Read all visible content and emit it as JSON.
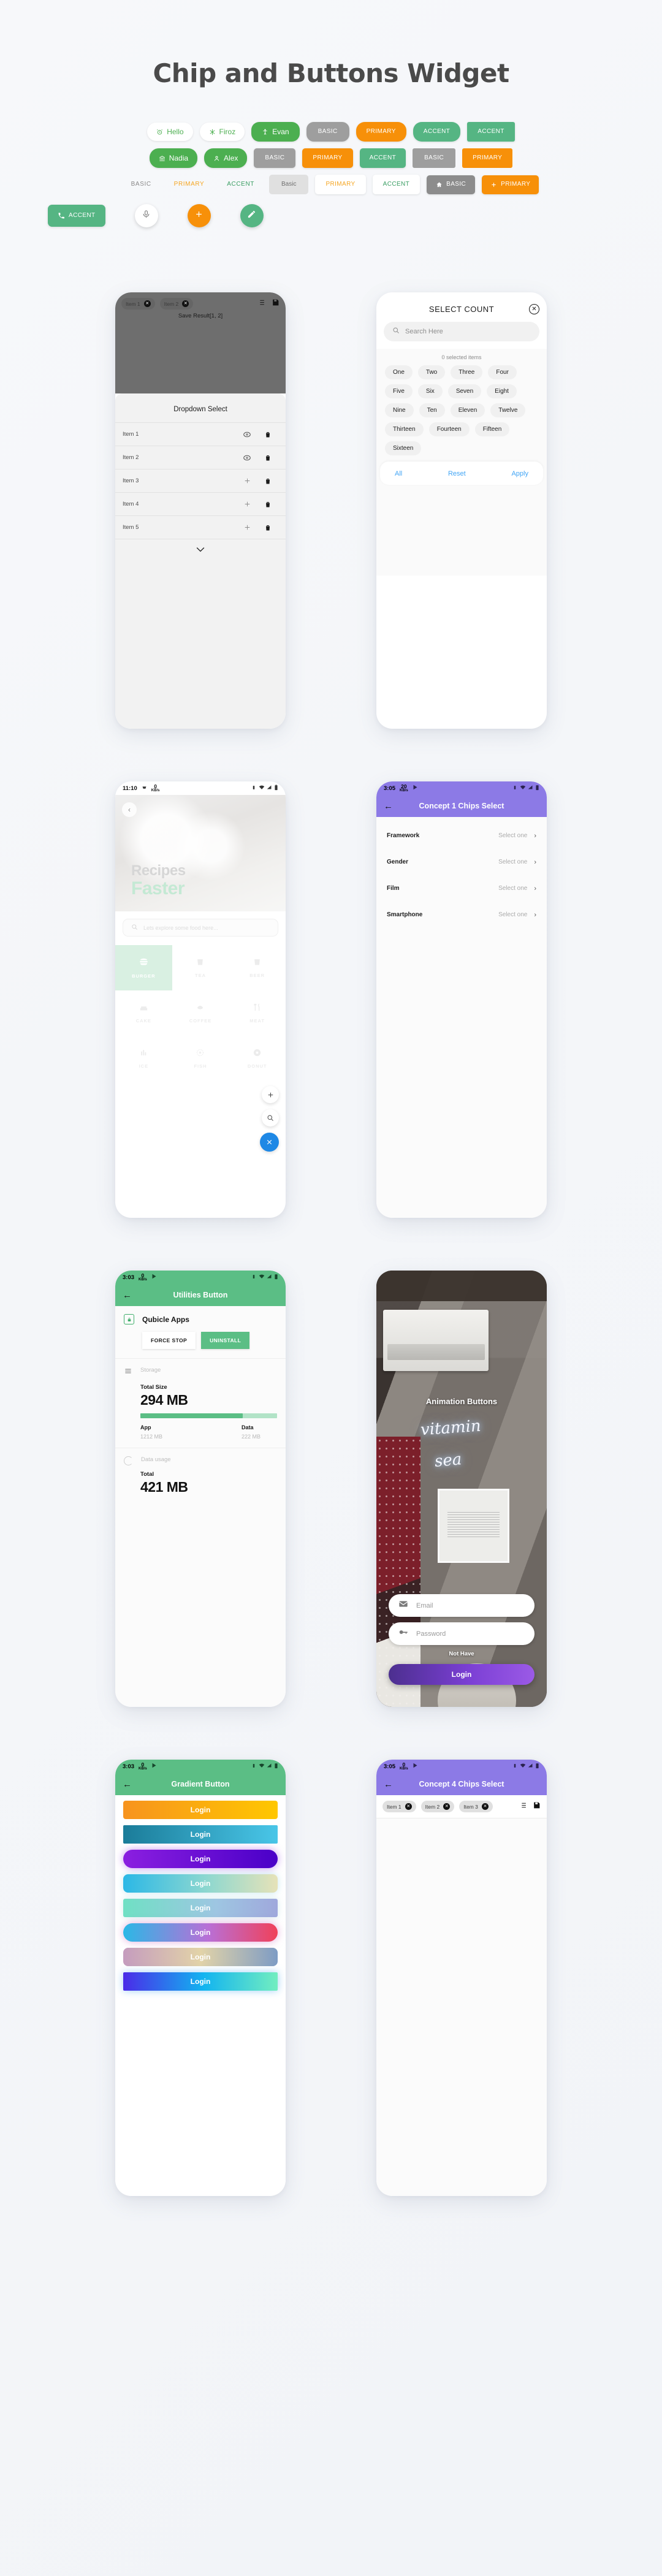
{
  "page": {
    "title": "Chip and Buttons Widget"
  },
  "chip_rows": [
    {
      "id": "row-1",
      "chips": [
        {
          "label": "Hello",
          "style": "c-white-round",
          "icon": "alarm-icon"
        },
        {
          "label": "Firoz",
          "style": "c-white-round",
          "icon": "snowflake-icon"
        },
        {
          "label": "Evan",
          "style": "c-green-round",
          "icon": "accessibility-icon"
        },
        {
          "label": "BASIC",
          "style": "c-gray-soft",
          "icon": ""
        },
        {
          "label": "PRIMARY",
          "style": "c-orange-soft",
          "icon": ""
        },
        {
          "label": "ACCENT",
          "style": "c-accent-soft",
          "icon": ""
        },
        {
          "label": "ACCENT",
          "style": "c-accent-sq",
          "icon": ""
        }
      ]
    },
    {
      "id": "row-2",
      "chips": [
        {
          "label": "Nadia",
          "style": "c-green-round2",
          "icon": "bank-icon"
        },
        {
          "label": "Alex",
          "style": "c-green-round2",
          "icon": "person-icon"
        },
        {
          "label": "BASIC",
          "style": "c-gray-sq",
          "icon": ""
        },
        {
          "label": "PRIMARY",
          "style": "c-orange-sq",
          "icon": ""
        },
        {
          "label": "ACCENT",
          "style": "c-accent-sq2",
          "icon": ""
        },
        {
          "label": "BASIC",
          "style": "c-gray-flat",
          "icon": ""
        },
        {
          "label": "PRIMARY",
          "style": "c-orange-flat",
          "icon": ""
        }
      ]
    },
    {
      "id": "row-3",
      "chips": [
        {
          "label": "BASIC",
          "style": "c-text-basic",
          "icon": ""
        },
        {
          "label": "PRIMARY",
          "style": "c-text-primary",
          "icon": ""
        },
        {
          "label": "ACCENT",
          "style": "c-text-accent",
          "icon": ""
        },
        {
          "label": "Basic",
          "style": "c-tonal-basic",
          "icon": ""
        },
        {
          "label": "PRIMARY",
          "style": "c-outline-primary",
          "icon": ""
        },
        {
          "label": "ACCENT",
          "style": "c-outline-accent",
          "icon": ""
        },
        {
          "label": "BASIC",
          "style": "c-gray-icon",
          "icon": "home-icon"
        },
        {
          "label": "PRIMARY",
          "style": "c-orange-icon",
          "icon": "plus-icon"
        }
      ]
    },
    {
      "id": "row-4",
      "chips": [
        {
          "label": "ACCENT",
          "style": "c-green-call",
          "icon": "phone-icon"
        },
        {
          "label": "",
          "style": "fab fab-white",
          "icon": "mic-icon"
        },
        {
          "label": "",
          "style": "fab fab-orange",
          "icon": "plus-icon"
        },
        {
          "label": "",
          "style": "fab fab-green",
          "icon": "pencil-icon"
        }
      ]
    }
  ],
  "phone_dropdown": {
    "name": "Dropdown Select",
    "top_chips": [
      {
        "label": "Item 1"
      },
      {
        "label": "Item 2"
      }
    ],
    "save_result": "Save Result[1, 2]",
    "sheet_title": "Dropdown Select",
    "items": [
      {
        "label": "Item 1",
        "action": "radio-selected-icon"
      },
      {
        "label": "Item 2",
        "action": "radio-selected-icon"
      },
      {
        "label": "Item 3",
        "action": "plus-icon"
      },
      {
        "label": "Item 4",
        "action": "plus-icon"
      },
      {
        "label": "Item 5",
        "action": "plus-icon"
      }
    ]
  },
  "phone_select_count": {
    "title": "SELECT COUNT",
    "search_placeholder": "Search Here",
    "selected_count": "0 selected items",
    "options": [
      "One",
      "Two",
      "Three",
      "Four",
      "Five",
      "Six",
      "Seven",
      "Eight",
      "Nine",
      "Ten",
      "Eleven",
      "Twelve",
      "Thirteen",
      "Fourteen",
      "Fifteen",
      "Sixteen"
    ],
    "actions": {
      "all": "All",
      "reset": "Reset",
      "apply": "Apply"
    }
  },
  "phone_recipes": {
    "status": {
      "time": "11:10",
      "net_value": "0",
      "net_unit": "KB/s"
    },
    "headline_1": "Recipes",
    "headline_2": "Faster",
    "search_placeholder": "Lets explore some food here...",
    "categories": [
      {
        "label": "BURGER",
        "icon": "burger-icon",
        "active": true
      },
      {
        "label": "TEA",
        "icon": "cup-icon",
        "active": false
      },
      {
        "label": "BEER",
        "icon": "cup-icon",
        "active": false
      },
      {
        "label": "CAKE",
        "icon": "cake-icon",
        "active": false
      },
      {
        "label": "COFFEE",
        "icon": "coffee-icon",
        "active": false
      },
      {
        "label": "MEAT",
        "icon": "cutlery-icon",
        "active": false
      },
      {
        "label": "ICE",
        "icon": "ice-icon",
        "active": false
      },
      {
        "label": "FISH",
        "icon": "fish-icon",
        "active": false
      },
      {
        "label": "DONUT",
        "icon": "donut-icon",
        "active": false
      }
    ],
    "fabs": [
      "plus-icon",
      "search-icon",
      "close-icon"
    ]
  },
  "phone_concept1": {
    "status": {
      "time": "3:05",
      "net_value": "20",
      "net_unit": "KB/s"
    },
    "title": "Concept 1 Chips Select",
    "rows": [
      {
        "name": "Framework",
        "value": "Select one"
      },
      {
        "name": "Gender",
        "value": "Select one"
      },
      {
        "name": "Film",
        "value": "Select one"
      },
      {
        "name": "Smartphone",
        "value": "Select one"
      }
    ]
  },
  "phone_utilities": {
    "status": {
      "time": "3:03",
      "net_value": "0",
      "net_unit": "KB/s"
    },
    "title": "Utilities Button",
    "app_name": "Qubicle Apps",
    "buttons": {
      "force_stop": "FORCE STOP",
      "uninstall": "UNINSTALL"
    },
    "storage": {
      "label": "Storage",
      "total_label": "Total Size",
      "total_value": "294 MB",
      "app_label": "App",
      "app_value": "1212 MB",
      "data_label": "Data",
      "data_value": "222 MB",
      "app_percent": 75
    },
    "data_usage": {
      "label": "Data usage",
      "total_label": "Total",
      "total_value": "421 MB"
    }
  },
  "phone_animation": {
    "title": "Animation Buttons",
    "email_placeholder": "Email",
    "password_placeholder": "Password",
    "not_have": "Not Have",
    "login_label": "Login",
    "neon_line1": "vitamin",
    "neon_line2": "sea"
  },
  "phone_gradient": {
    "status": {
      "time": "3:03",
      "net_value": "0",
      "net_unit": "KB/s"
    },
    "title": "Gradient Button",
    "buttons": [
      {
        "label": "Login",
        "radius": "4px",
        "gradient": "linear-gradient(90deg,#F7931E 0%,#FFC700 100%)",
        "glow": "none"
      },
      {
        "label": "Login",
        "radius": "2px",
        "gradient": "linear-gradient(90deg,#1B7C99 0%,#49C6E8 100%)",
        "glow": "none"
      },
      {
        "label": "Login",
        "radius": "18px",
        "gradient": "linear-gradient(90deg,#8B1FE0 0%,#4A00C8 100%)",
        "glow": "0 0 13px rgba(150,60,230,.55)"
      },
      {
        "label": "Login",
        "radius": "8px",
        "gradient": "linear-gradient(90deg,#2BB8E6 0%,#8FD8CF 55%,#E6E2B8 100%)",
        "glow": "0 0 11px rgba(120,200,220,.4)"
      },
      {
        "label": "Login",
        "radius": "3px",
        "gradient": "linear-gradient(90deg,#6FE0C4 0%,#9EC6E2 60%,#9FA8DC 100%)",
        "glow": "0 0 11px rgba(140,200,210,.35)"
      },
      {
        "label": "Login",
        "radius": "18px",
        "gradient": "linear-gradient(90deg,#2BB8E6 0%,#B96FD6 55%,#F0415A 100%)",
        "glow": "0 0 13px rgba(200,90,190,.5)"
      },
      {
        "label": "Login",
        "radius": "8px",
        "gradient": "linear-gradient(90deg,#C59CBE 0%,#E2D3A8 50%,#7E9CC4 100%)",
        "glow": "none"
      },
      {
        "label": "Login",
        "radius": "2px",
        "gradient": "linear-gradient(90deg,#4A2BE8 0%,#12B4F0 52%,#72EEC0 100%)",
        "glow": "0 0 13px rgba(80,170,240,.55)"
      }
    ]
  },
  "phone_concept4": {
    "status": {
      "time": "3:05",
      "net_value": "0",
      "net_unit": "KB/s"
    },
    "title": "Concept 4 Chips Select",
    "chips": [
      {
        "label": "Item 1"
      },
      {
        "label": "Item 2"
      },
      {
        "label": "Item 3"
      }
    ]
  },
  "colors": {
    "green": "#4CAF50",
    "accent": "#55b583",
    "primary_orange": "#F79009",
    "basic_gray": "#9e9e9e",
    "purple": "#8c7ae6",
    "appbar_green": "#5BBE85",
    "link_blue": "#42A5F5"
  }
}
